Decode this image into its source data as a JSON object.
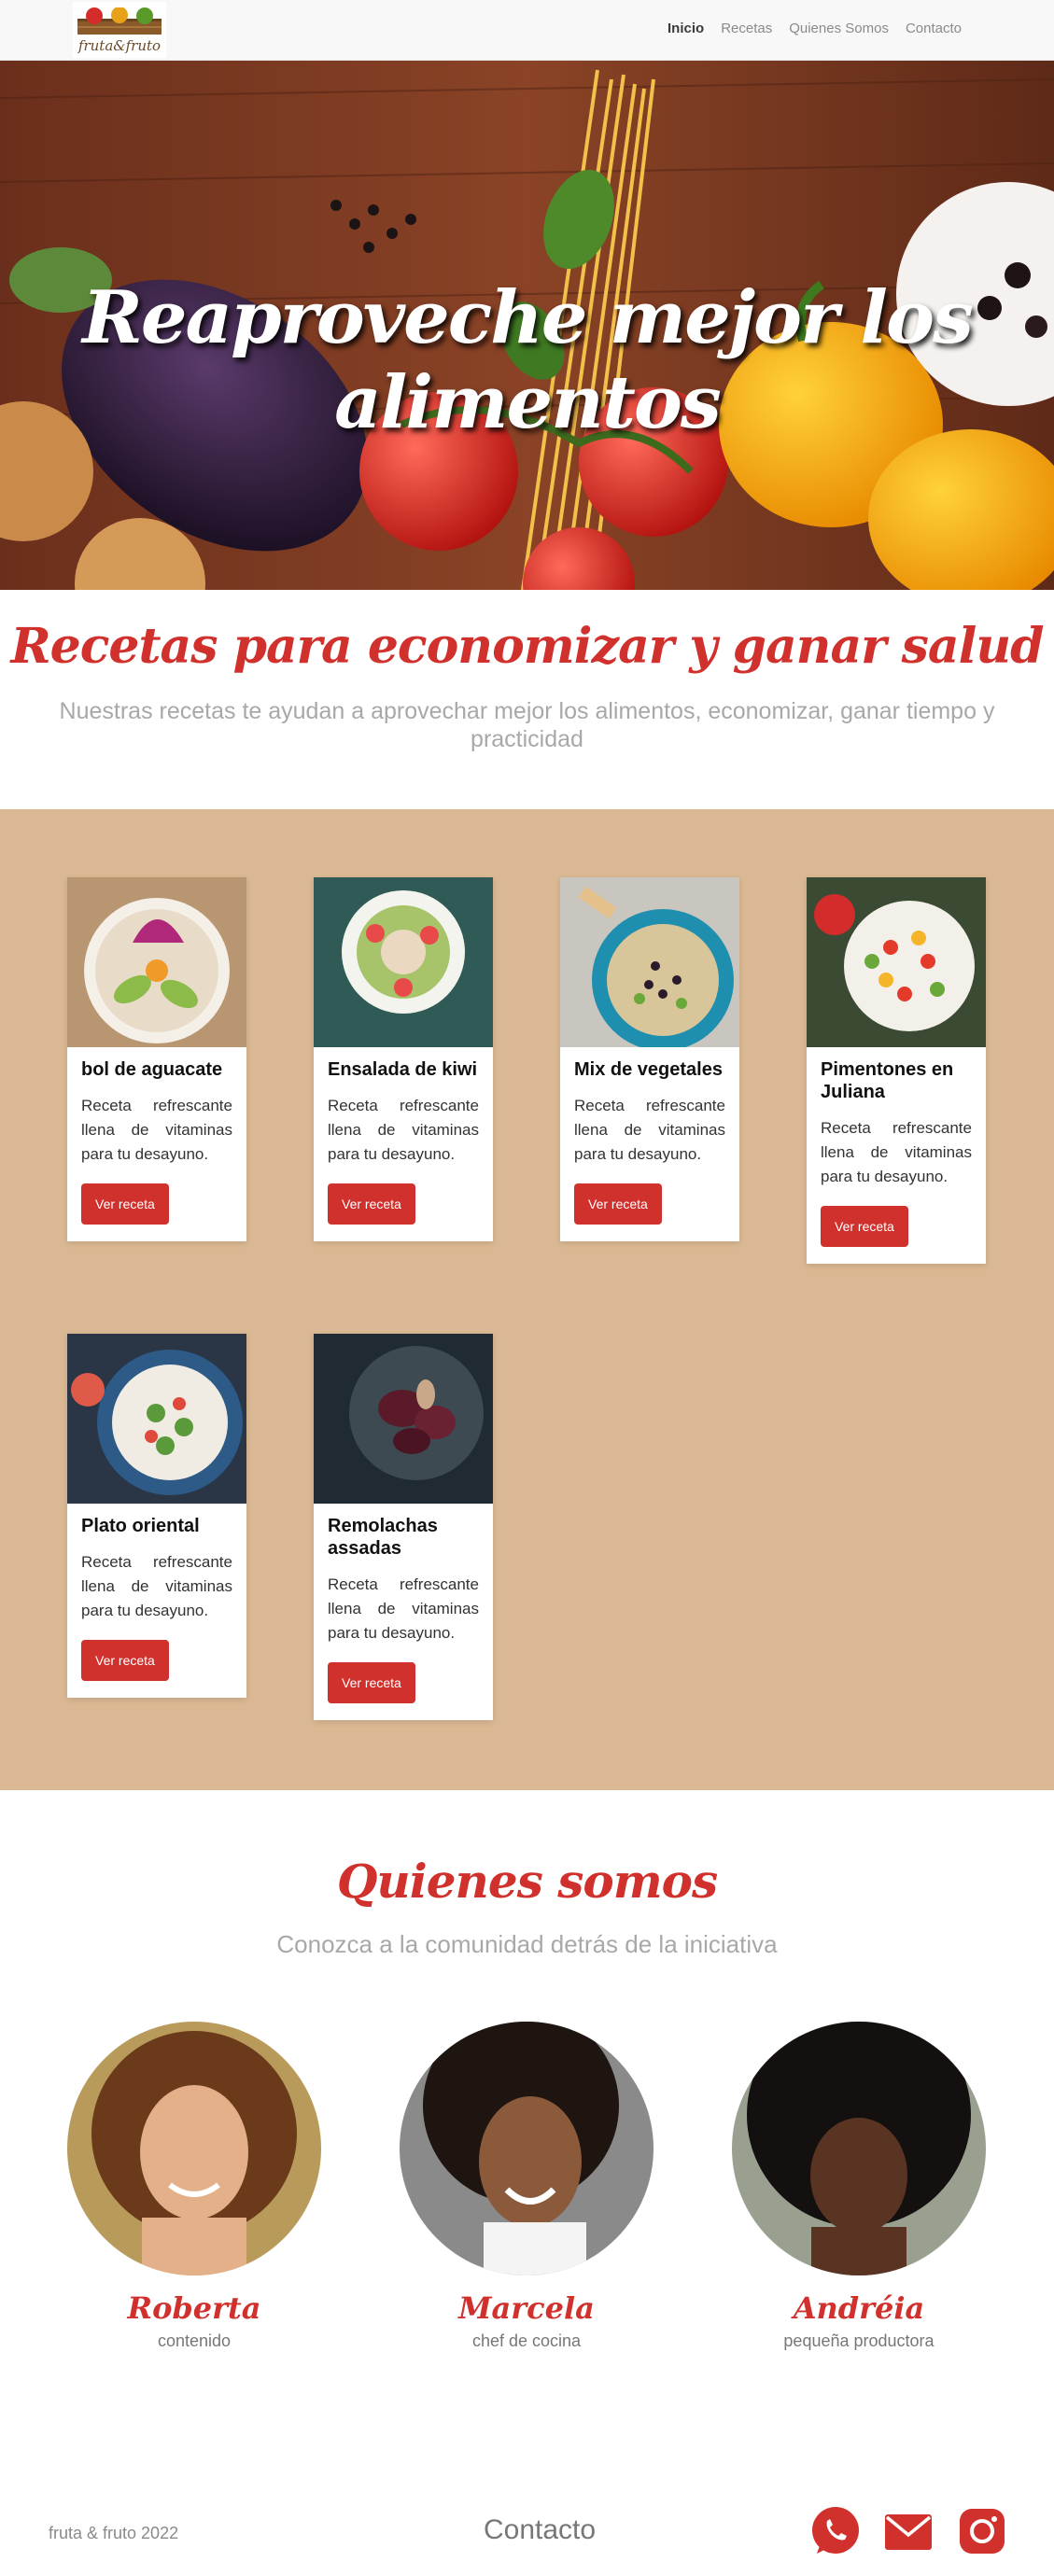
{
  "nav": {
    "logo_text": "fruta&fruto",
    "links": [
      {
        "label": "Inicio",
        "active": true
      },
      {
        "label": "Recetas",
        "active": false
      },
      {
        "label": "Quienes Somos",
        "active": false
      },
      {
        "label": "Contacto",
        "active": false
      }
    ]
  },
  "hero": {
    "title": "Reaproveche mejor los alimentos"
  },
  "intro": {
    "title": "Recetas para economizar y ganar salud",
    "subtitle": "Nuestras recetas te ayudan a aprovechar mejor los alimentos, economizar, ganar tiempo y practicidad"
  },
  "recipes": [
    {
      "title": "bol de aguacate",
      "text": "Receta refrescante llena de vitaminas para tu desayuno.",
      "button": "Ver receta"
    },
    {
      "title": "Ensalada de kiwi",
      "text": "Receta refrescante llena de vitaminas para tu desayuno.",
      "button": "Ver receta"
    },
    {
      "title": "Mix de vegetales",
      "text": "Receta refrescante llena de vitaminas para tu desayuno.",
      "button": "Ver receta"
    },
    {
      "title": "Pimentones en Juliana",
      "text": "Receta refrescante llena de vitaminas para tu desayuno.",
      "button": "Ver receta"
    },
    {
      "title": "Plato oriental",
      "text": "Receta refrescante llena de vitaminas para tu desayuno.",
      "button": "Ver receta"
    },
    {
      "title": "Remolachas assadas",
      "text": "Receta refrescante llena de vitaminas para tu desayuno.",
      "button": "Ver receta"
    }
  ],
  "about": {
    "title": "Quienes somos",
    "subtitle": "Conozca a la comunidad detrás de la iniciativa",
    "people": [
      {
        "name": "Roberta",
        "role": "contenido"
      },
      {
        "name": "Marcela",
        "role": "chef de cocina"
      },
      {
        "name": "Andréia",
        "role": "pequeña productora"
      }
    ]
  },
  "footer": {
    "copyright": "fruta & fruto 2022",
    "contact": "Contacto",
    "icons": [
      "whatsapp-icon",
      "mail-icon",
      "instagram-icon"
    ]
  },
  "colors": {
    "accent": "#d0312d",
    "section_bg": "#dab893"
  }
}
